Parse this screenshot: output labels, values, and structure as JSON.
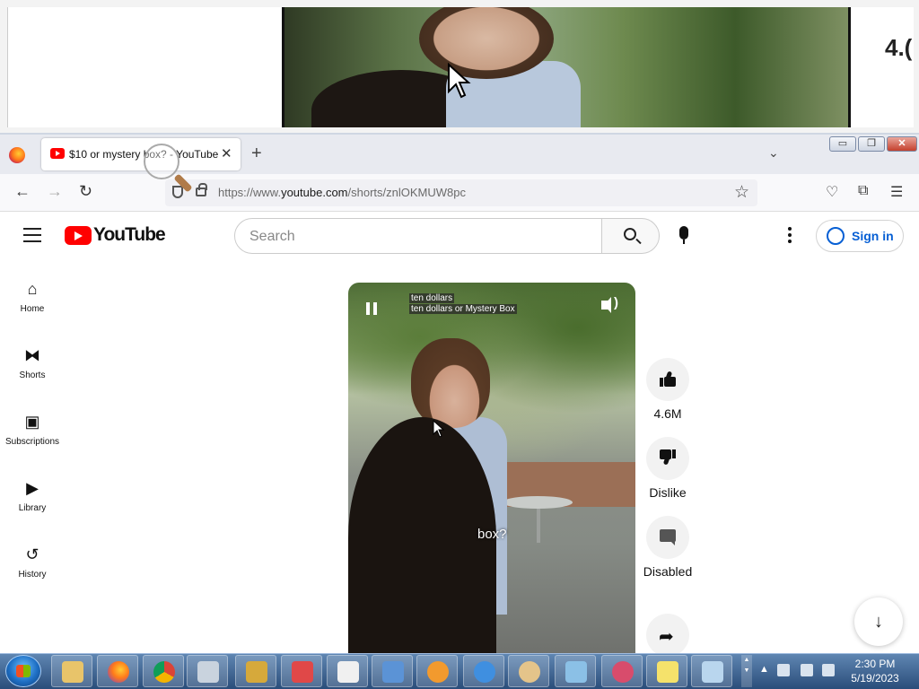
{
  "magnifier": {
    "partial_text": "4.("
  },
  "browser": {
    "tab_title": "$10 or mystery box? - YouTube",
    "tab_close": "✕",
    "new_tab": "+",
    "tab_list": "⌄",
    "url_prefix": "https://www.",
    "url_domain": "youtube.com",
    "url_path": "/shorts/znlOKMUW8pc",
    "window_buttons": {
      "minimize": "▭",
      "restore": "❐",
      "close": "✕"
    }
  },
  "youtube": {
    "logo_text": "YouTube",
    "search_placeholder": "Search",
    "signin_label": "Sign in"
  },
  "sidebar": {
    "items": [
      {
        "label": "Home",
        "icon": "home-icon",
        "glyph": "⌂"
      },
      {
        "label": "Shorts",
        "icon": "shorts-icon",
        "glyph": "⧓"
      },
      {
        "label": "Subscriptions",
        "icon": "subscriptions-icon",
        "glyph": "▣"
      },
      {
        "label": "Library",
        "icon": "library-icon",
        "glyph": "▶"
      },
      {
        "label": "History",
        "icon": "history-icon",
        "glyph": "↺"
      }
    ]
  },
  "player": {
    "caption_line1": "ten dollars",
    "caption_line2": "ten dollars or Mystery Box",
    "subtitle": "box?"
  },
  "actions": {
    "like_count": "4.6M",
    "dislike_label": "Dislike",
    "comments_label": "Disabled"
  },
  "taskbar": {
    "time": "2:30 PM",
    "date": "5/19/2023"
  },
  "colors": {
    "youtube_red": "#ff0000",
    "signin_blue": "#065fd4",
    "taskbar": "#2a4d7a"
  }
}
